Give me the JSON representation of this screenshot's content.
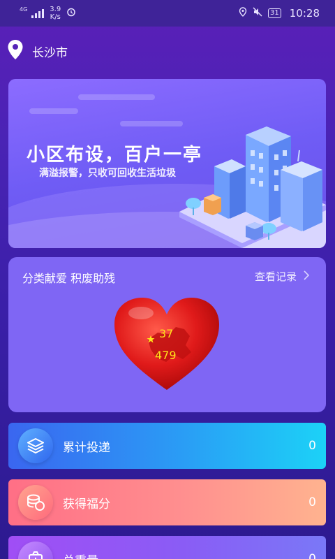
{
  "status_bar": {
    "network": "4G",
    "speed_value": "3.9",
    "speed_unit": "K/s",
    "battery": "31",
    "time": "10:28"
  },
  "location": {
    "city": "长沙市",
    "icon": "location-pin-icon"
  },
  "banner": {
    "title": "小区布设，百户一亭",
    "subtitle": "满溢报警，只收可回收生活垃圾"
  },
  "donation": {
    "title": "分类献爱 积废助残",
    "record_link": "查看记录",
    "heart_value_top": "37",
    "heart_value_bottom": "479"
  },
  "stats": [
    {
      "label": "累计投递",
      "value": "0",
      "icon": "layers-icon"
    },
    {
      "label": "获得福分",
      "value": "0",
      "icon": "coins-icon"
    },
    {
      "label": "总重量",
      "value": "0",
      "icon": "scale-icon"
    }
  ],
  "colors": {
    "background": "#4a23b5",
    "card": "#7f66f4",
    "heart_text": "#ffe31a"
  }
}
